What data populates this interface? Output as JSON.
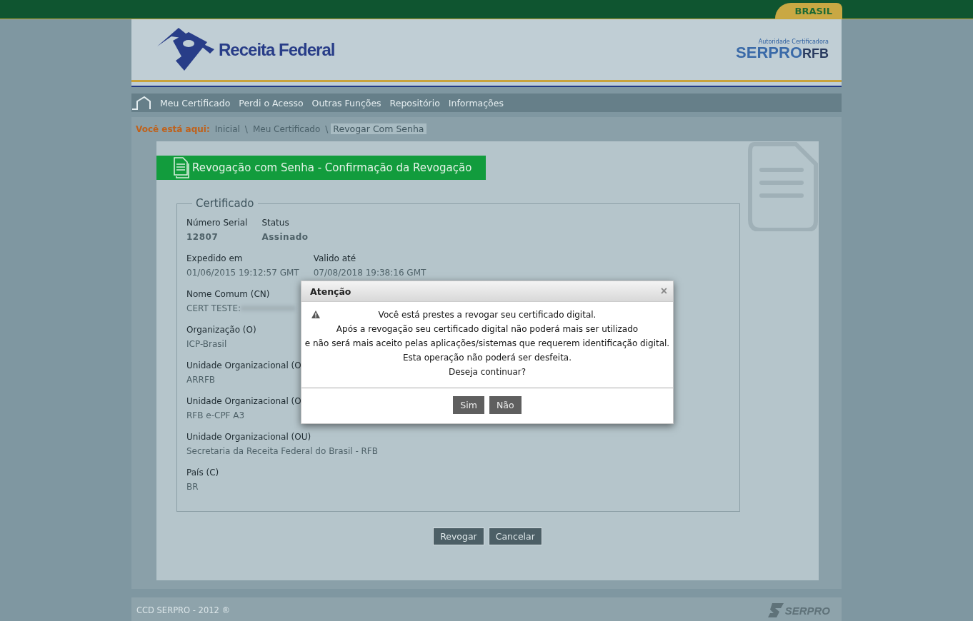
{
  "top_bar": {
    "badge": "BRASIL"
  },
  "header": {
    "logo_text": "Receita Federal",
    "authority_caption": "Autoridade Certificadora",
    "authority_name": "SERPRO",
    "authority_suffix": "RFB"
  },
  "nav": {
    "items": [
      "Meu Certificado",
      "Perdi o Acesso",
      "Outras Funções",
      "Repositório",
      "Informações"
    ]
  },
  "breadcrumb": {
    "label": "Você está aqui:",
    "items": [
      {
        "text": "Inicial",
        "current": false
      },
      {
        "text": "Meu Certificado",
        "current": false
      },
      {
        "text": "Revogar Com Senha",
        "current": true
      }
    ],
    "separator": "\\"
  },
  "page_title": "Revogação com Senha - Confirmação da Revogação",
  "certificate": {
    "legend": "Certificado",
    "rows": [
      [
        {
          "label": "Número Serial",
          "value": "12807",
          "bold": true
        },
        {
          "label": "Status",
          "value": "Assinado",
          "bold": true
        }
      ],
      [
        {
          "label": "Expedido em",
          "value": "01/06/2015 19:12:57 GMT",
          "bold": false
        },
        {
          "label": "Valido até",
          "value": "07/08/2018 19:38:16 GMT",
          "bold": false
        }
      ],
      [
        {
          "label": "Nome Comum (CN)",
          "value": "CERT TESTE:",
          "bold": false,
          "redacted": true
        }
      ],
      [
        {
          "label": "Organização (O)",
          "value": "ICP-Brasil",
          "bold": false
        }
      ],
      [
        {
          "label": "Unidade Organizacional (O",
          "value": "ARRFB",
          "bold": false
        }
      ],
      [
        {
          "label": "Unidade Organizacional (O",
          "value": "RFB e-CPF A3",
          "bold": false
        }
      ],
      [
        {
          "label": "Unidade Organizacional (OU)",
          "value": "Secretaria da Receita Federal do Brasil - RFB",
          "bold": false
        }
      ],
      [
        {
          "label": "País (C)",
          "value": "BR",
          "bold": false
        }
      ]
    ]
  },
  "actions": [
    "Revogar",
    "Cancelar"
  ],
  "footer": {
    "copyright": "CCD SERPRO - 2012 ®",
    "logo_text": "SERPRO"
  },
  "dialog": {
    "title": "Atenção",
    "close": "×",
    "lines": [
      "Você está prestes a revogar seu certificado digital.",
      "Após a revogação seu certificado digital não poderá mais ser utilizado",
      "e não será mais aceito pelas aplicações/sistemas que requerem identificação digital.",
      "Esta operação não poderá ser desfeita.",
      "Deseja continuar?"
    ],
    "buttons": [
      "Sim",
      "Não"
    ]
  }
}
